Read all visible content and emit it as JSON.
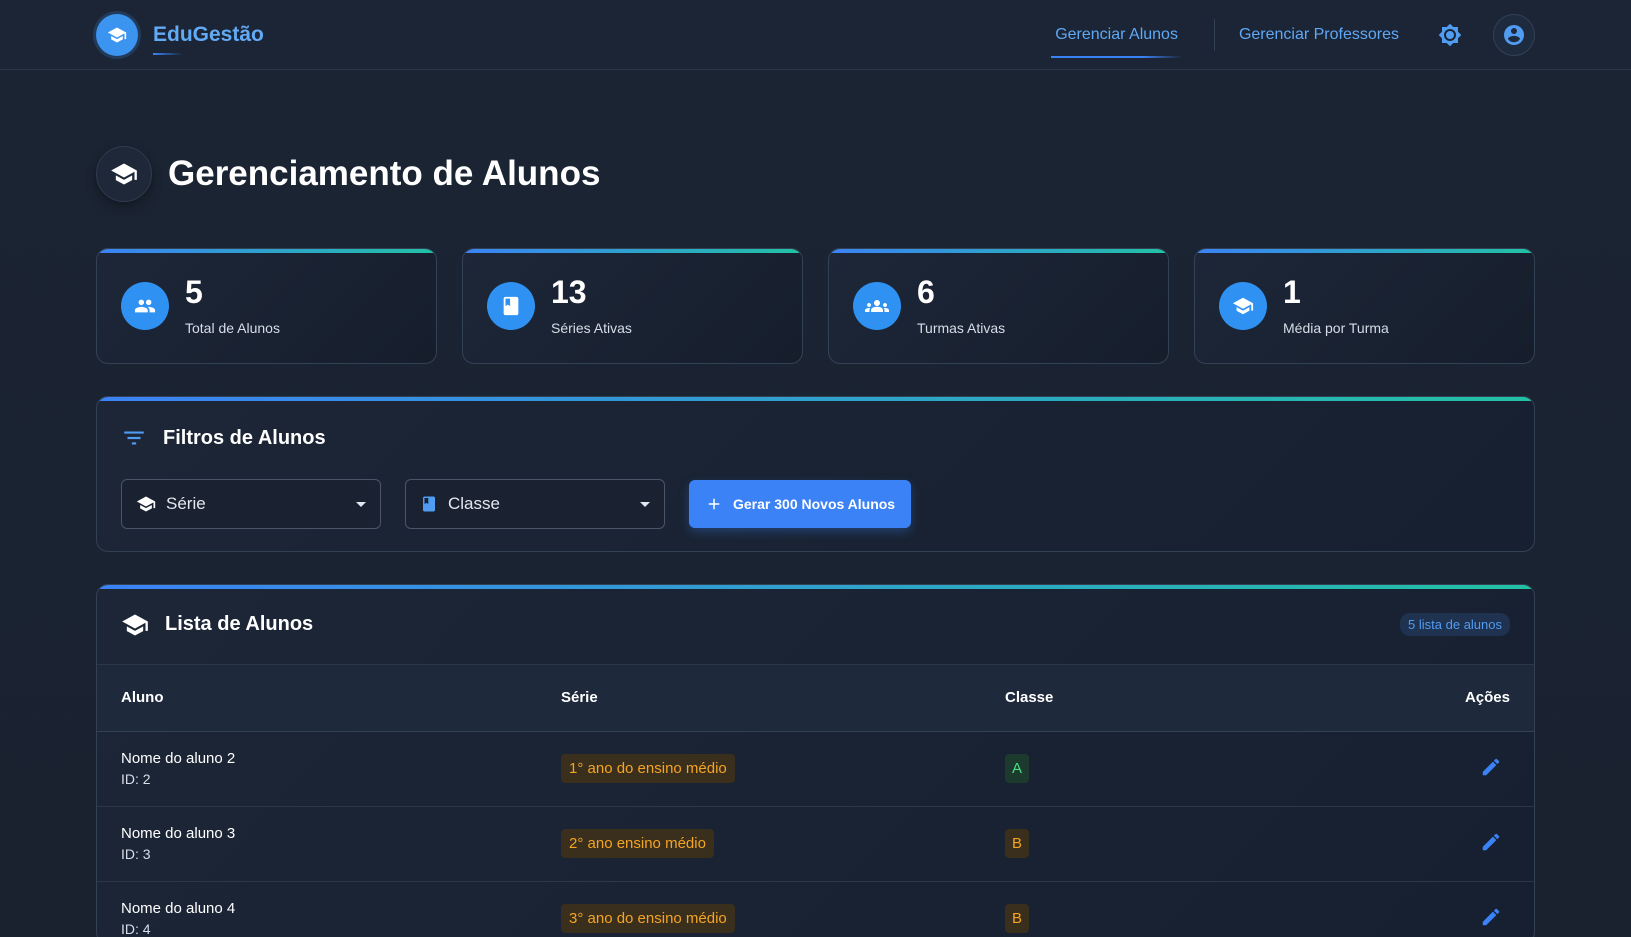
{
  "brand": {
    "name": "EduGestão",
    "logo_icon": "graduation-cap-icon"
  },
  "nav": {
    "links": [
      {
        "label": "Gerenciar Alunos",
        "active": true
      },
      {
        "label": "Gerenciar Professores",
        "active": false
      }
    ],
    "theme_icon": "sun-icon",
    "user_icon": "user-circle-icon"
  },
  "page": {
    "title": "Gerenciamento de Alunos",
    "icon": "graduation-cap-icon"
  },
  "stats": [
    {
      "value": "5",
      "label": "Total de Alunos",
      "icon": "people-icon"
    },
    {
      "value": "13",
      "label": "Séries Ativas",
      "icon": "book-icon"
    },
    {
      "value": "6",
      "label": "Turmas Ativas",
      "icon": "groups-icon"
    },
    {
      "value": "1",
      "label": "Média por Turma",
      "icon": "graduation-cap-icon"
    }
  ],
  "filters": {
    "title": "Filtros de Alunos",
    "serie_label": "Série",
    "classe_label": "Classe",
    "generate_label": "Gerar 300 Novos Alunos"
  },
  "list": {
    "title": "Lista de Alunos",
    "count_badge": "5 lista de alunos",
    "columns": {
      "aluno": "Aluno",
      "serie": "Série",
      "classe": "Classe",
      "acoes": "Ações"
    },
    "rows": [
      {
        "name": "Nome do aluno 2",
        "id": "ID: 2",
        "serie": "1° ano do ensino médio",
        "classe": "A"
      },
      {
        "name": "Nome do aluno 3",
        "id": "ID: 3",
        "serie": "2° ano ensino médio",
        "classe": "B"
      },
      {
        "name": "Nome do aluno 4",
        "id": "ID: 4",
        "serie": "3° ano do ensino médio",
        "classe": "B"
      }
    ]
  },
  "colors": {
    "accent": "#3b82f6",
    "teal": "#22c1a4",
    "background": "#1b2433"
  }
}
